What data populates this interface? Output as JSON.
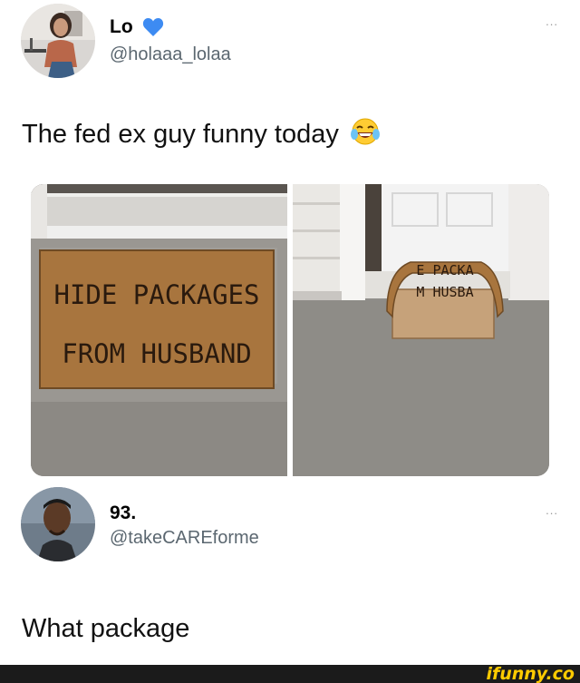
{
  "tweet": {
    "author": {
      "name": "Lo",
      "handle": "@holaaa_lolaa"
    },
    "text": "The fed ex guy funny today",
    "emoji": "laughing-tears",
    "photos": {
      "left_mat_lines": [
        "HIDE PACKAGES",
        "FROM HUSBAND"
      ],
      "right_mat_lines": [
        "E PACKA",
        "M HUSBA"
      ]
    }
  },
  "reply": {
    "author": {
      "name": "93.",
      "handle": "@takeCAREforme"
    },
    "text": "What package"
  },
  "more_label": "...",
  "watermark": "ifunny.co",
  "colors": {
    "verified_heart": "#3d8bf2",
    "handle_gray": "#5b6770",
    "mat_brown": "#a8753e",
    "watermark_yellow": "#ffcb00"
  }
}
